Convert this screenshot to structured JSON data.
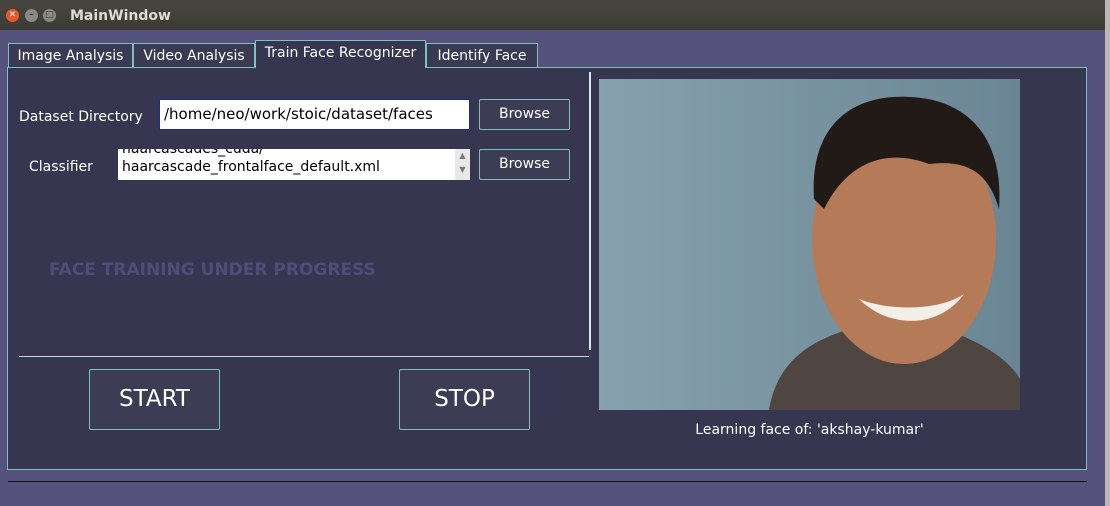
{
  "window": {
    "title": "MainWindow"
  },
  "tabs": [
    {
      "label": "Image Analysis"
    },
    {
      "label": "Video Analysis"
    },
    {
      "label": "Train Face Recognizer"
    },
    {
      "label": "Identify Face"
    }
  ],
  "active_tab": "Train Face Recognizer",
  "form": {
    "dataset_label": "Dataset Directory",
    "dataset_value": "/home/neo/work/stoic/dataset/faces",
    "classifier_label": "Classifier",
    "classifier_line1": "haarcascades_cuda/",
    "classifier_line2": "haarcascade_frontalface_default.xml",
    "browse_label": "Browse"
  },
  "status": "FACE TRAINING UNDER PROGRESS",
  "start_label": "START",
  "stop_label": "STOP",
  "caption": "Learning face of: 'akshay-kumar'",
  "colors": {
    "frame": "#55527e",
    "panel": "#363650",
    "accent": "#7fbfc0",
    "status_text": "#4e4c78"
  }
}
